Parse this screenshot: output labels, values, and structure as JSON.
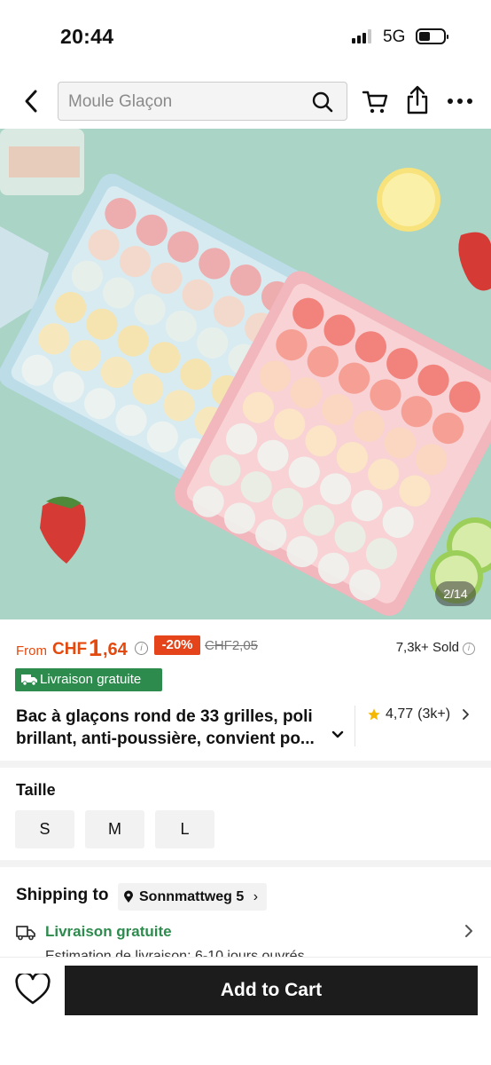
{
  "status_bar": {
    "time": "20:44",
    "network": "5G"
  },
  "search": {
    "placeholder": "Moule Glaçon"
  },
  "nav_icons": [
    "back-chevron-icon",
    "search-icon",
    "cart-icon",
    "share-icon",
    "more-icon"
  ],
  "gallery": {
    "counter": "2/14"
  },
  "price": {
    "from_label": "From",
    "currency": "CHF",
    "amount_int": "1",
    "amount_dec": ",64",
    "discount": "-20%",
    "original": "CHF2,05",
    "sold": "7,3k+ Sold"
  },
  "shipping_badge": "Livraison gratuite",
  "product": {
    "title": "Bac à glaçons rond de 33 grilles, poli\nbrillant, anti-poussière, convient po...",
    "rating": "4,77",
    "rating_count": "(3k+)"
  },
  "size": {
    "label": "Taille",
    "options": [
      "S",
      "M",
      "L"
    ]
  },
  "shipping": {
    "to_label": "Shipping to",
    "address": "Sonnmattweg 5",
    "free_label": "Livraison gratuite",
    "estimate": "Estimation de livraison: 6-10 jours ouvrés"
  },
  "actions": {
    "add_to_cart": "Add to Cart"
  },
  "colors": {
    "accent": "#e34a0f",
    "discount": "#e5431a",
    "green": "#2e8b4e",
    "button": "#1c1c1c",
    "star": "#f5b800"
  }
}
